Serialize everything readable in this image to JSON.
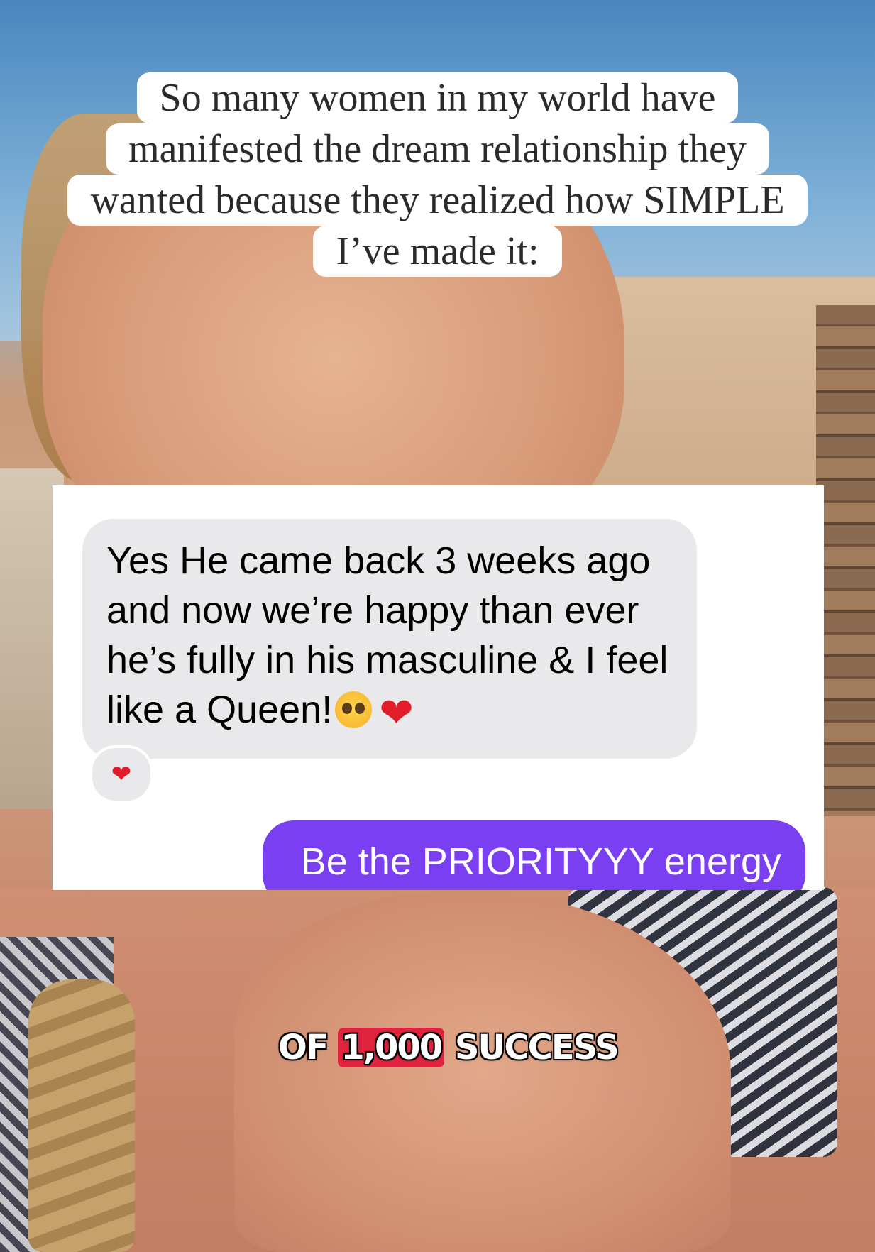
{
  "caption": {
    "lines": [
      "So many women in my world have",
      "manifested the dream relationship they",
      "wanted because they realized how SIMPLE",
      "I’ve made it:"
    ]
  },
  "chat": {
    "incoming_message": "Yes He came back 3 weeks ago and now we’re happy than ever he’s fully in his masculine & I feel like a Queen!",
    "incoming_emojis": [
      "pleading-face-emoji",
      "red-heart-emoji"
    ],
    "reaction": "red-heart-emoji",
    "outgoing_message": "Be the PRIORITYYY energy",
    "incoming_bubble_color": "#e9e9eb",
    "outgoing_bubble_color": "#7b3ff2"
  },
  "subtitle": {
    "prefix": "OF",
    "highlight": "1,000",
    "suffix": "SUCCESS",
    "highlight_color": "#e0243f"
  }
}
